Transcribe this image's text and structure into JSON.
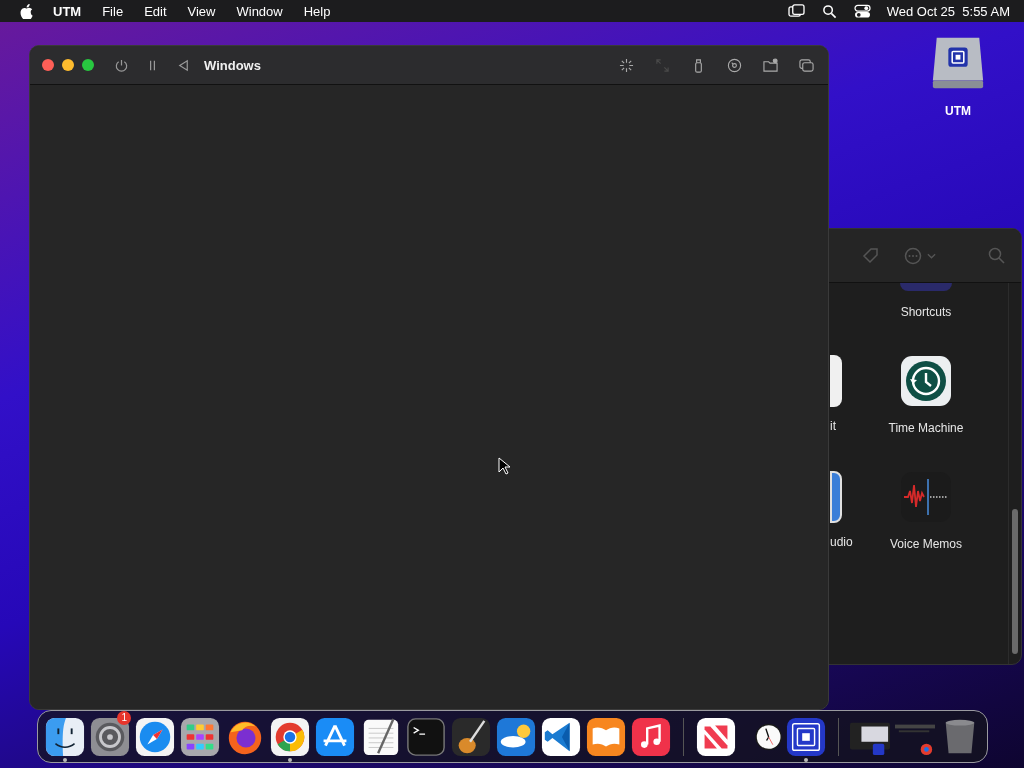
{
  "menu_bar": {
    "app_name": "UTM",
    "menus": [
      "File",
      "Edit",
      "View",
      "Window",
      "Help"
    ],
    "clock": "Wed Oct 25  5:55 AM"
  },
  "desktop_icons": [
    {
      "label": "UTM"
    }
  ],
  "vm_window": {
    "title": "Windows",
    "toolbar": [
      {
        "kind": "display",
        "disabled": false
      },
      {
        "kind": "resize",
        "disabled": true
      },
      {
        "kind": "usb",
        "disabled": false
      },
      {
        "kind": "disc",
        "disabled": false
      },
      {
        "kind": "folder",
        "disabled": false
      },
      {
        "kind": "windows",
        "disabled": false
      }
    ]
  },
  "apps_window": {
    "left_column": [
      {
        "label": "it",
        "kind": "notes"
      },
      {
        "label": "udio",
        "kind": "blue"
      }
    ],
    "items": [
      {
        "label": "Shortcuts",
        "kind": "shortcuts"
      },
      {
        "label": "Time Machine",
        "kind": "timemachine"
      },
      {
        "label": "Voice Memos",
        "kind": "voicememos"
      }
    ]
  },
  "dock": {
    "groups": [
      [
        {
          "kind": "finder",
          "running": true
        },
        {
          "kind": "settings",
          "running": false,
          "badge": "1"
        },
        {
          "kind": "safari",
          "running": false
        },
        {
          "kind": "launchpad",
          "running": false
        },
        {
          "kind": "firefox",
          "running": false
        },
        {
          "kind": "chrome",
          "running": true
        },
        {
          "kind": "appstore",
          "running": false
        },
        {
          "kind": "textedit",
          "running": false
        },
        {
          "kind": "terminal",
          "running": false
        },
        {
          "kind": "garageband",
          "running": false
        },
        {
          "kind": "weather",
          "running": false
        },
        {
          "kind": "vscode",
          "running": false
        },
        {
          "kind": "books",
          "running": false
        },
        {
          "kind": "music",
          "running": false
        }
      ],
      [
        {
          "kind": "news",
          "running": false
        },
        {
          "kind": "clock",
          "running": false
        },
        {
          "kind": "utm",
          "running": true
        }
      ],
      [
        {
          "kind": "minimized",
          "running": false
        },
        {
          "kind": "minimized_chrome",
          "running": false
        },
        {
          "kind": "trash",
          "running": false
        }
      ]
    ]
  }
}
